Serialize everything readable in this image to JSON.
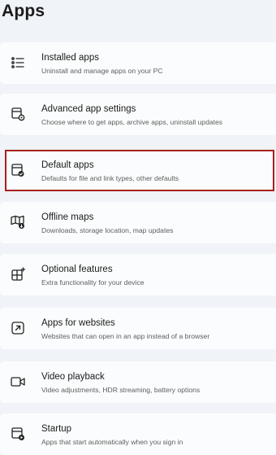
{
  "page": {
    "title": "Apps"
  },
  "items": [
    {
      "icon": "installed-apps-icon",
      "title": "Installed apps",
      "subtitle": "Uninstall and manage apps on your PC"
    },
    {
      "icon": "advanced-app-settings-icon",
      "title": "Advanced app settings",
      "subtitle": "Choose where to get apps, archive apps, uninstall updates"
    },
    {
      "icon": "default-apps-icon",
      "title": "Default apps",
      "subtitle": "Defaults for file and link types, other defaults",
      "selected": true
    },
    {
      "icon": "offline-maps-icon",
      "title": "Offline maps",
      "subtitle": "Downloads, storage location, map updates"
    },
    {
      "icon": "optional-features-icon",
      "title": "Optional features",
      "subtitle": "Extra functionality for your device"
    },
    {
      "icon": "apps-for-websites-icon",
      "title": "Apps for websites",
      "subtitle": "Websites that can open in an app instead of a browser"
    },
    {
      "icon": "video-playback-icon",
      "title": "Video playback",
      "subtitle": "Video adjustments, HDR streaming, battery options"
    },
    {
      "icon": "startup-icon",
      "title": "Startup",
      "subtitle": "Apps that start automatically when you sign in"
    }
  ],
  "colors": {
    "background": "#f0f3f8",
    "card": "#fbfcfd",
    "highlight_border": "#a5221e"
  }
}
